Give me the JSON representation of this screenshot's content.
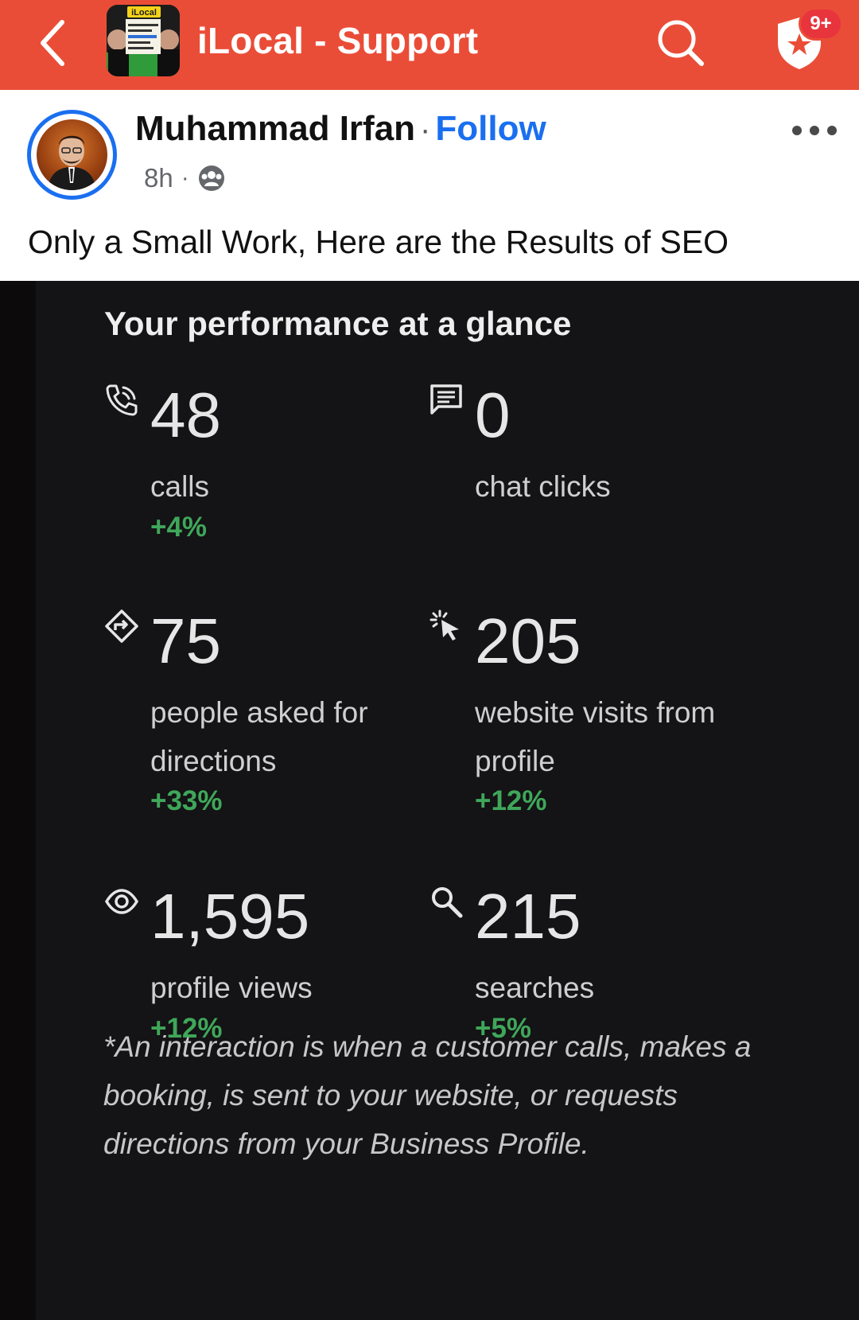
{
  "header": {
    "group_name": "iLocal - Support",
    "notification_badge": "9+",
    "accent_color": "#ea4d37",
    "thumbnail_text": "iLocal"
  },
  "post": {
    "author_name": "Muhammad Irfan",
    "separator": "·",
    "follow_label": "Follow",
    "time": "8h",
    "text": "Only a Small Work, Here are the Results of SEO"
  },
  "panel": {
    "title": "Your performance at a glance",
    "metrics": [
      {
        "icon": "phone-call-icon",
        "value": "48",
        "label": "calls",
        "change": "+4%"
      },
      {
        "icon": "chat-icon",
        "value": "0",
        "label": "chat clicks",
        "change": ""
      },
      {
        "icon": "directions-icon",
        "value": "75",
        "label": "people asked for directions",
        "change": "+33%"
      },
      {
        "icon": "click-cursor-icon",
        "value": "205",
        "label": "website visits from profile",
        "change": "+12%"
      },
      {
        "icon": "eye-icon",
        "value": "1,595",
        "label": "profile views",
        "change": "+12%"
      },
      {
        "icon": "search-icon",
        "value": "215",
        "label": "searches",
        "change": "+5%"
      }
    ],
    "footnote": "*An interaction is when a customer calls, makes a booking, is sent to your website, or requests directions from your Business Profile.",
    "positive_color": "#3fa75a"
  }
}
